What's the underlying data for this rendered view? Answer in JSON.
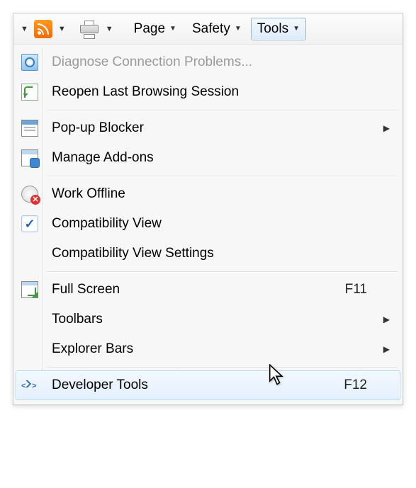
{
  "toolbar": {
    "page_label": "Page",
    "safety_label": "Safety",
    "tools_label": "Tools"
  },
  "menu": {
    "diagnose": "Diagnose Connection Problems...",
    "reopen": "Reopen Last Browsing Session",
    "popup": "Pop-up Blocker",
    "addons": "Manage Add-ons",
    "offline": "Work Offline",
    "compat": "Compatibility View",
    "compat_settings": "Compatibility View Settings",
    "fullscreen": "Full Screen",
    "fullscreen_key": "F11",
    "toolbars": "Toolbars",
    "explorer_bars": "Explorer Bars",
    "devtools": "Developer Tools",
    "devtools_key": "F12"
  }
}
